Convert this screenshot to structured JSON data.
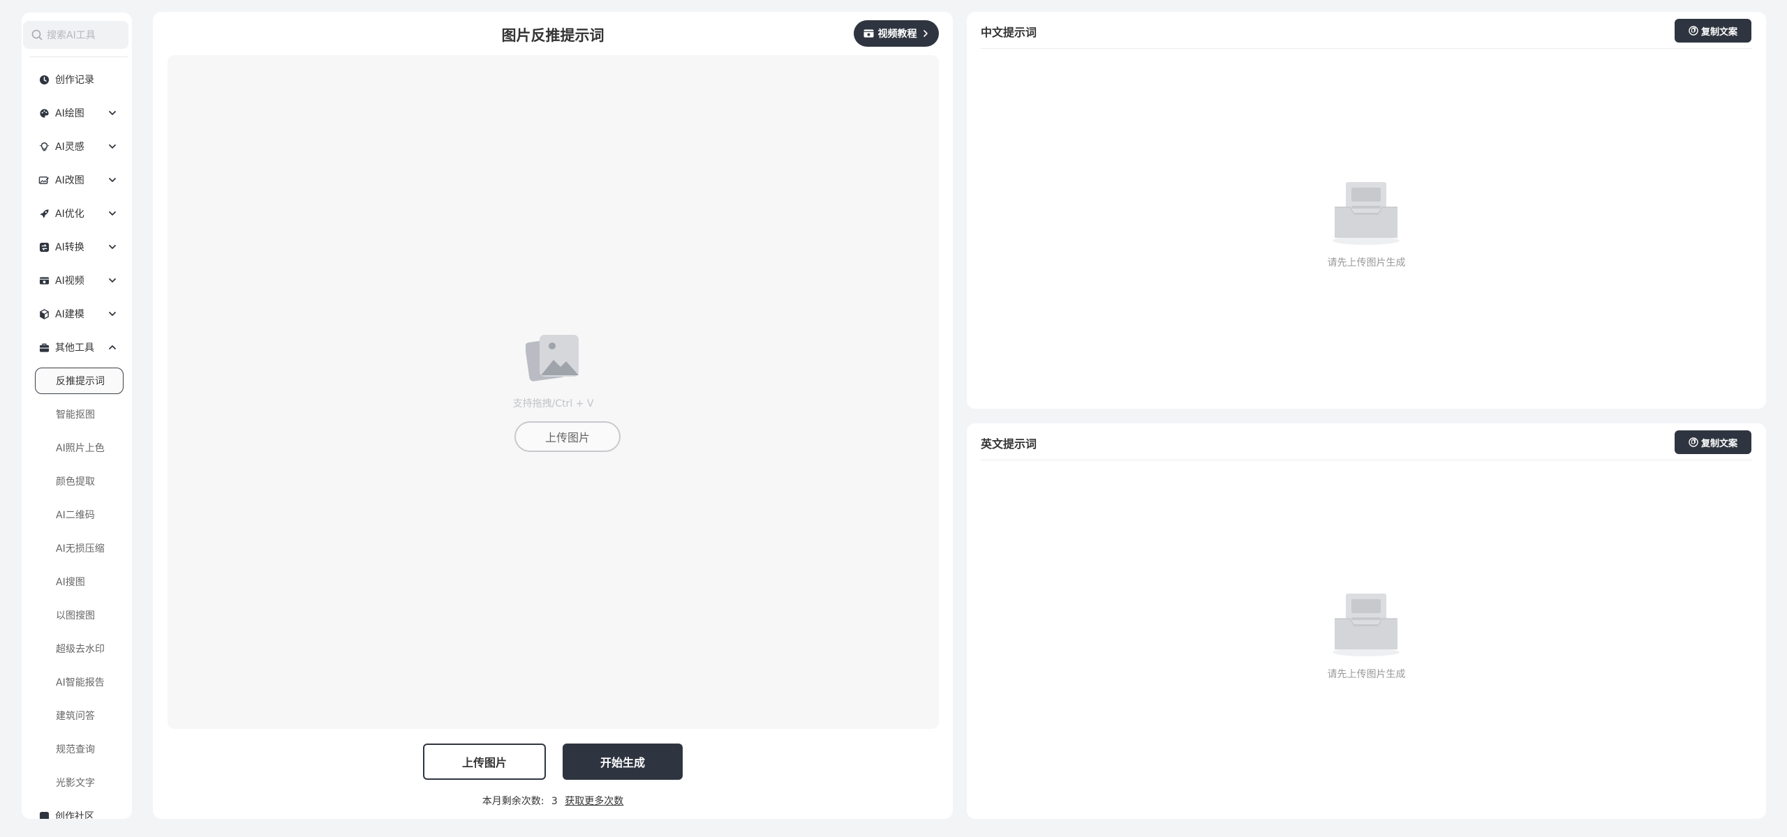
{
  "sidebar": {
    "search_placeholder": "搜索AI工具",
    "items": [
      {
        "label": "创作记录",
        "icon": "clock-icon",
        "expandable": false
      },
      {
        "label": "AI绘图",
        "icon": "palette-icon",
        "expandable": true
      },
      {
        "label": "AI灵感",
        "icon": "lightbulb-icon",
        "expandable": true
      },
      {
        "label": "AI改图",
        "icon": "image-edit-icon",
        "expandable": true
      },
      {
        "label": "AI优化",
        "icon": "rocket-icon",
        "expandable": true
      },
      {
        "label": "AI转换",
        "icon": "convert-icon",
        "expandable": true
      },
      {
        "label": "AI视频",
        "icon": "video-icon",
        "expandable": true
      },
      {
        "label": "AI建模",
        "icon": "cube-icon",
        "expandable": true
      },
      {
        "label": "其他工具",
        "icon": "toolbox-icon",
        "expandable": true,
        "expanded": true
      }
    ],
    "sub_items": [
      "反推提示词",
      "智能抠图",
      "AI照片上色",
      "颜色提取",
      "AI二维码",
      "AI无损压缩",
      "AI搜图",
      "以图搜图",
      "超级去水印",
      "AI智能报告",
      "建筑问答",
      "规范查询",
      "光影文字"
    ],
    "active_sub_item": "反推提示词",
    "trailing_item": "创作社区"
  },
  "main": {
    "title": "图片反推提示词",
    "video_button": "视频教程",
    "drop_hint": "支持拖拽/Ctrl + V",
    "drop_upload_label": "上传图片",
    "upload_button": "上传图片",
    "generate_button": "开始生成",
    "quota_label": "本月剩余次数:",
    "quota_value": "3",
    "quota_link": "获取更多次数"
  },
  "output_cn": {
    "title": "中文提示词",
    "copy_button": "复制文案",
    "empty_text": "请先上传图片生成"
  },
  "output_en": {
    "title": "英文提示词",
    "copy_button": "复制文案",
    "empty_text": "请先上传图片生成"
  },
  "colors": {
    "accent": "#2f3540",
    "background": "#f3f4f6",
    "panel": "#ffffff"
  }
}
